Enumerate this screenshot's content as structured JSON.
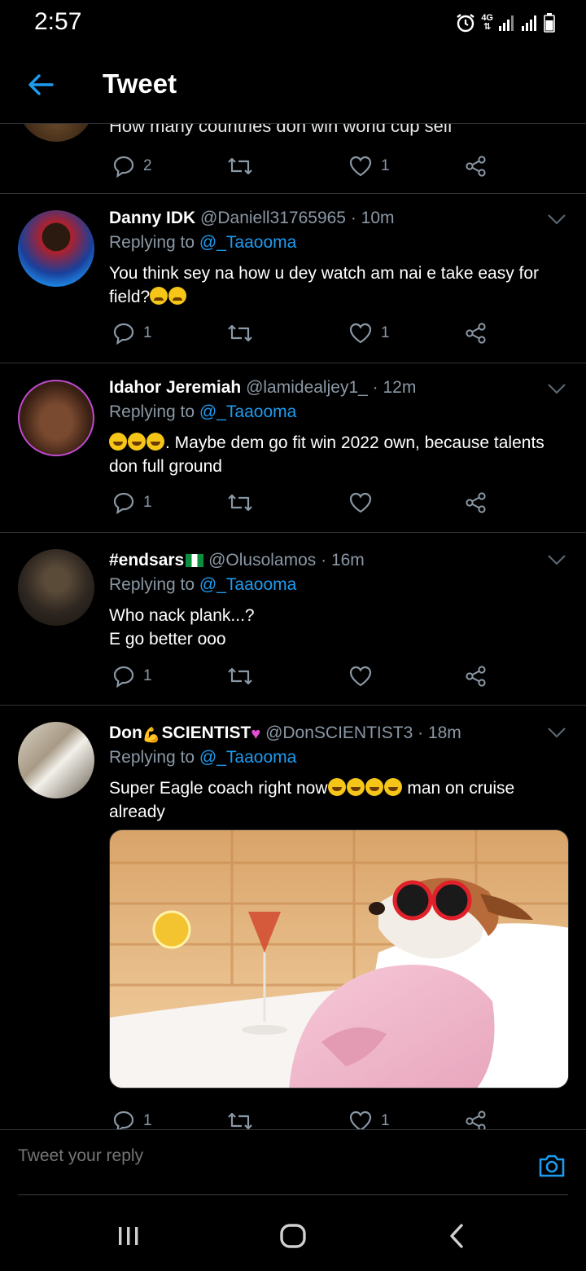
{
  "status_bar": {
    "time": "2:57",
    "network": "4G",
    "icons": [
      "alarm-icon",
      "signal-icon",
      "signal-icon",
      "battery-icon"
    ]
  },
  "app_bar": {
    "title": "Tweet",
    "back_icon": "back-arrow-icon"
  },
  "top_stub": {
    "text": "How many countries don win world cup self",
    "replies": "2",
    "retweets": "",
    "likes": "1"
  },
  "tweets": [
    {
      "name": "Danny IDK",
      "handle": "@Daniell31765965",
      "time": "· 10m",
      "replying_label": "Replying to",
      "replying_to": "@_Taaooma",
      "body": "You think sey na how u dey watch am nai e take easy for field?",
      "emoji": [
        "worried-face",
        "worried-face"
      ],
      "replies": "1",
      "retweets": "",
      "likes": "1"
    },
    {
      "name": "Idahor Jeremiah",
      "handle": "@lamidealjey1_",
      "time": "· 12m",
      "replying_label": "Replying to",
      "replying_to": "@_Taaooma",
      "body_emoji": [
        "grinning-squinting-face",
        "grinning-squinting-face",
        "grinning-squinting-face"
      ],
      "body": ". Maybe dem go fit win 2022 own, because talents don full ground",
      "replies": "1",
      "retweets": "",
      "likes": ""
    },
    {
      "name": "#endsars",
      "handle": "@Olusolamos",
      "time": "· 16m",
      "replying_label": "Replying to",
      "replying_to": "@_Taaooma",
      "body_line1": "Who nack plank...?",
      "body_line2": "E go better ooo",
      "replies": "1",
      "retweets": "",
      "likes": ""
    },
    {
      "name_part1": "Don",
      "name_part2": "SCIENTIST",
      "handle": "@DonSCIENTIST3",
      "time": "· 18m",
      "replying_label": "Replying to",
      "replying_to": "@_Taaooma",
      "body_part1": "Super Eagle coach right now",
      "body_part2": " man on cruise already",
      "media_alt": "dog-in-bathrobe-photo",
      "replies": "1",
      "retweets": "",
      "likes": "1"
    }
  ],
  "reply_bar": {
    "placeholder": "Tweet your reply",
    "camera_icon": "camera-icon"
  },
  "nav_bar": {
    "buttons": [
      "recents-icon",
      "home-icon",
      "back-icon"
    ]
  },
  "colors": {
    "background": "#000000",
    "accent": "#1d9bf0",
    "muted": "#8b98a5",
    "divider": "#2f3336"
  }
}
